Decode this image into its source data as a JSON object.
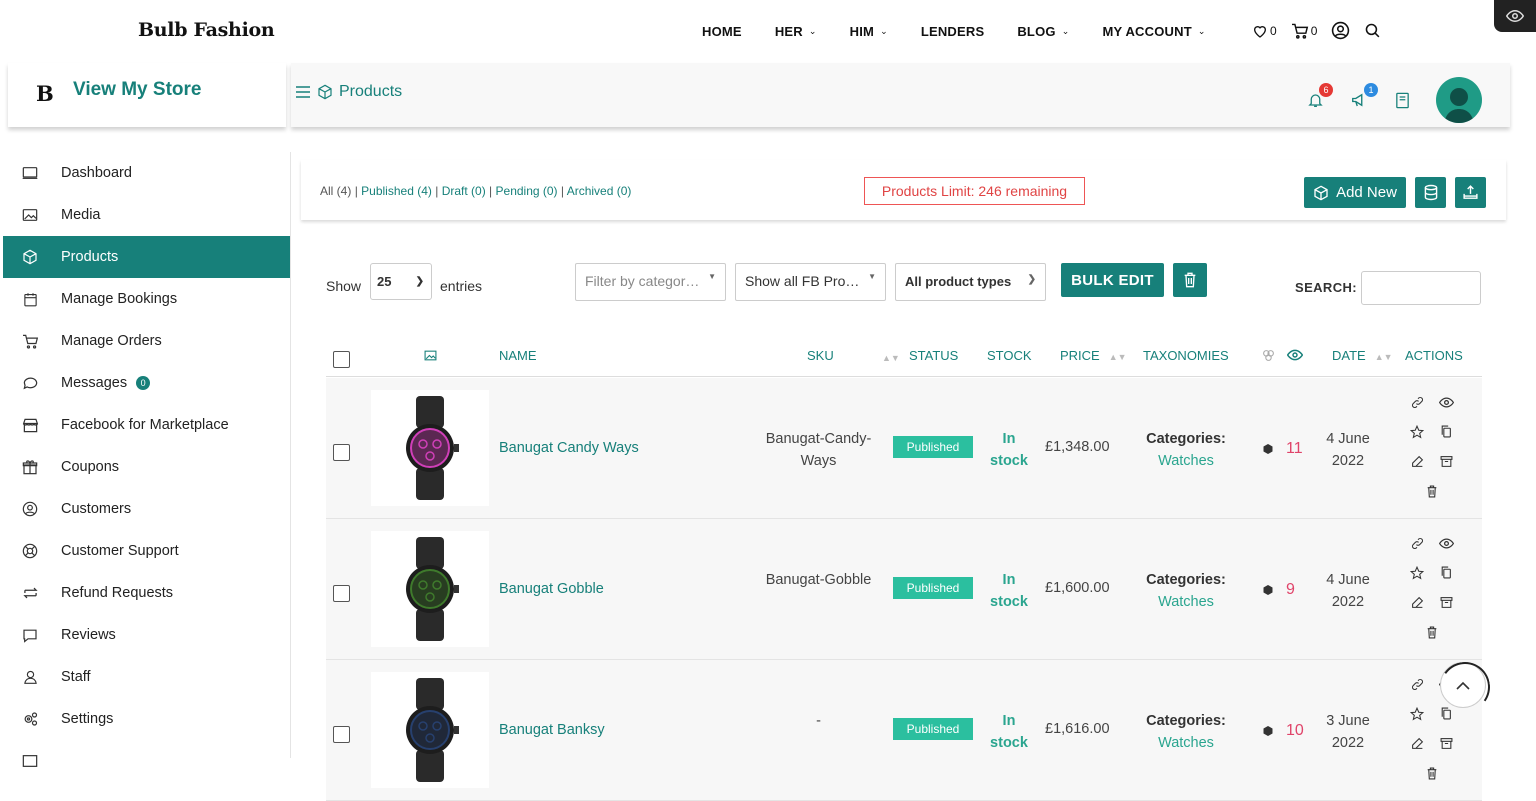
{
  "site": {
    "brand": "Bulb Fashion",
    "menu": [
      {
        "label": "HOME",
        "dropdown": false
      },
      {
        "label": "HER",
        "dropdown": true
      },
      {
        "label": "HIM",
        "dropdown": true
      },
      {
        "label": "LENDERS",
        "dropdown": false
      },
      {
        "label": "BLOG",
        "dropdown": true
      },
      {
        "label": "MY ACCOUNT",
        "dropdown": true
      }
    ],
    "wishlist_count": "0",
    "cart_count": "0"
  },
  "header": {
    "logo_letter": "B",
    "store_link": "View My Store",
    "breadcrumb": "Products",
    "notifications_count": "6",
    "announcements_count": "1"
  },
  "sidebar": {
    "items": [
      {
        "label": "Dashboard",
        "icon": "monitor-icon"
      },
      {
        "label": "Media",
        "icon": "image-icon"
      },
      {
        "label": "Products",
        "icon": "cube-icon",
        "active": true
      },
      {
        "label": "Manage Bookings",
        "icon": "calendar-icon"
      },
      {
        "label": "Manage Orders",
        "icon": "cart-icon"
      },
      {
        "label": "Messages",
        "icon": "chat-icon",
        "badge": "0"
      },
      {
        "label": "Facebook for Marketplace",
        "icon": "store-icon"
      },
      {
        "label": "Coupons",
        "icon": "gift-icon"
      },
      {
        "label": "Customers",
        "icon": "user-circle-icon"
      },
      {
        "label": "Customer Support",
        "icon": "lifebuoy-icon"
      },
      {
        "label": "Refund Requests",
        "icon": "refund-icon"
      },
      {
        "label": "Reviews",
        "icon": "comment-icon"
      },
      {
        "label": "Staff",
        "icon": "user-icon"
      },
      {
        "label": "Settings",
        "icon": "gears-icon"
      }
    ]
  },
  "filters": {
    "all": "All (4)",
    "published": "Published (4)",
    "draft": "Draft (0)",
    "pending": "Pending (0)",
    "archived": "Archived (0)",
    "sep": "|"
  },
  "limit_text": "Products Limit: 246 remaining",
  "add_new": "Add New",
  "controls": {
    "show": "Show",
    "page_size": "25",
    "entries": "entries",
    "category_placeholder": "Filter by categor…",
    "fb_filter": "Show all FB Pro…",
    "product_types": "All product types",
    "bulk_edit": "BULK EDIT",
    "search_label": "SEARCH:"
  },
  "table": {
    "headers": {
      "name": "NAME",
      "sku": "SKU",
      "status": "STATUS",
      "stock": "STOCK",
      "price": "PRICE",
      "taxonomies": "TAXONOMIES",
      "date": "DATE",
      "actions": "ACTIONS"
    },
    "rows": [
      {
        "name": "Banugat Candy Ways",
        "sku_line1": "Banugat-Candy-",
        "sku_line2": "Ways",
        "status": "Published",
        "stock_line1": "In",
        "stock_line2": "stock",
        "price": "£1,348.00",
        "cat_label": "Categories:",
        "cat_value": "Watches",
        "views": "11",
        "date_line1": "4 June",
        "date_line2": "2022",
        "watch_color": "#d03fb8"
      },
      {
        "name": "Banugat Gobble",
        "sku_line1": "Banugat-Gobble",
        "sku_line2": "",
        "status": "Published",
        "stock_line1": "In",
        "stock_line2": "stock",
        "price": "£1,600.00",
        "cat_label": "Categories:",
        "cat_value": "Watches",
        "views": "9",
        "date_line1": "4 June",
        "date_line2": "2022",
        "watch_color": "#3f7a2c"
      },
      {
        "name": "Banugat Banksy",
        "sku_line1": "-",
        "sku_line2": "",
        "status": "Published",
        "stock_line1": "In",
        "stock_line2": "stock",
        "price": "£1,616.00",
        "cat_label": "Categories:",
        "cat_value": "Watches",
        "views": "10",
        "date_line1": "3 June",
        "date_line2": "2022",
        "watch_color": "#27406e"
      }
    ]
  },
  "colors": {
    "accent": "#17807a",
    "published": "#2bbf9f",
    "limit": "#e04444",
    "views": "#e0446a"
  }
}
